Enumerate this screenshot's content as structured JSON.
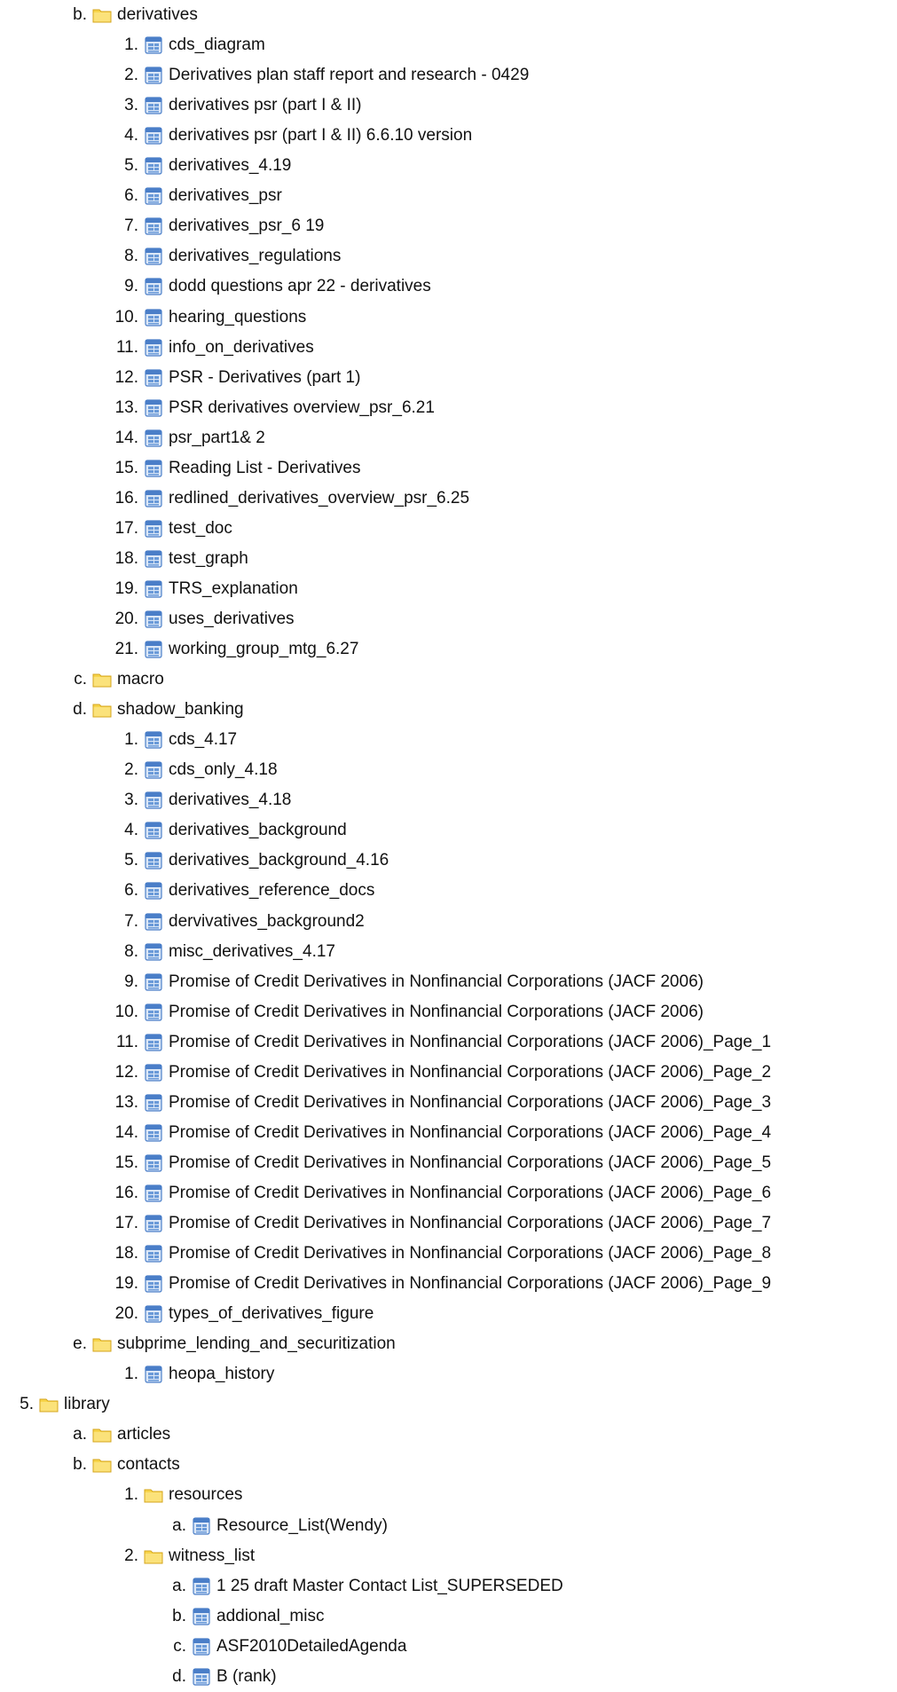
{
  "items": [
    {
      "marker": "b.",
      "type": "folder",
      "label": "derivatives"
    },
    {
      "marker": "1.",
      "type": "doc",
      "label": "cds_diagram"
    },
    {
      "marker": "2.",
      "type": "doc",
      "label": "Derivatives plan staff report and research - 0429"
    },
    {
      "marker": "3.",
      "type": "doc",
      "label": "derivatives psr (part I & II)"
    },
    {
      "marker": "4.",
      "type": "doc",
      "label": "derivatives psr (part I & II) 6.6.10 version"
    },
    {
      "marker": "5.",
      "type": "doc",
      "label": "derivatives_4.19"
    },
    {
      "marker": "6.",
      "type": "doc",
      "label": "derivatives_psr"
    },
    {
      "marker": "7.",
      "type": "doc",
      "label": "derivatives_psr_6 19"
    },
    {
      "marker": "8.",
      "type": "doc",
      "label": "derivatives_regulations"
    },
    {
      "marker": "9.",
      "type": "doc",
      "label": "dodd questions apr 22 - derivatives"
    },
    {
      "marker": "10.",
      "type": "doc",
      "label": "hearing_questions"
    },
    {
      "marker": "11.",
      "type": "doc",
      "label": "info_on_derivatives"
    },
    {
      "marker": "12.",
      "type": "doc",
      "label": "PSR - Derivatives (part 1)"
    },
    {
      "marker": "13.",
      "type": "doc",
      "label": "PSR derivatives overview_psr_6.21"
    },
    {
      "marker": "14.",
      "type": "doc",
      "label": "psr_part1& 2"
    },
    {
      "marker": "15.",
      "type": "doc",
      "label": "Reading List - Derivatives"
    },
    {
      "marker": "16.",
      "type": "doc",
      "label": "redlined_derivatives_overview_psr_6.25"
    },
    {
      "marker": "17.",
      "type": "doc",
      "label": "test_doc"
    },
    {
      "marker": "18.",
      "type": "doc",
      "label": "test_graph"
    },
    {
      "marker": "19.",
      "type": "doc",
      "label": "TRS_explanation"
    },
    {
      "marker": "20.",
      "type": "doc",
      "label": "uses_derivatives"
    },
    {
      "marker": "21.",
      "type": "doc",
      "label": "working_group_mtg_6.27"
    },
    {
      "marker": "c.",
      "type": "folder",
      "label": "macro"
    },
    {
      "marker": "d.",
      "type": "folder",
      "label": "shadow_banking"
    },
    {
      "marker": "1.",
      "type": "doc",
      "label": "cds_4.17"
    },
    {
      "marker": "2.",
      "type": "doc",
      "label": "cds_only_4.18"
    },
    {
      "marker": "3.",
      "type": "doc",
      "label": "derivatives_4.18"
    },
    {
      "marker": "4.",
      "type": "doc",
      "label": "derivatives_background"
    },
    {
      "marker": "5.",
      "type": "doc",
      "label": "derivatives_background_4.16"
    },
    {
      "marker": "6.",
      "type": "doc",
      "label": "derivatives_reference_docs"
    },
    {
      "marker": "7.",
      "type": "doc",
      "label": "dervivatives_background2"
    },
    {
      "marker": "8.",
      "type": "doc",
      "label": "misc_derivatives_4.17"
    },
    {
      "marker": "9.",
      "type": "doc",
      "label": "Promise of Credit Derivatives in Nonfinancial Corporations (JACF 2006)"
    },
    {
      "marker": "10.",
      "type": "doc",
      "label": "Promise of Credit Derivatives in Nonfinancial Corporations (JACF 2006)"
    },
    {
      "marker": "11.",
      "type": "doc",
      "label": "Promise of Credit Derivatives in Nonfinancial Corporations (JACF 2006)_Page_1"
    },
    {
      "marker": "12.",
      "type": "doc",
      "label": "Promise of Credit Derivatives in Nonfinancial Corporations (JACF 2006)_Page_2"
    },
    {
      "marker": "13.",
      "type": "doc",
      "label": "Promise of Credit Derivatives in Nonfinancial Corporations (JACF 2006)_Page_3"
    },
    {
      "marker": "14.",
      "type": "doc",
      "label": "Promise of Credit Derivatives in Nonfinancial Corporations (JACF 2006)_Page_4"
    },
    {
      "marker": "15.",
      "type": "doc",
      "label": "Promise of Credit Derivatives in Nonfinancial Corporations (JACF 2006)_Page_5"
    },
    {
      "marker": "16.",
      "type": "doc",
      "label": "Promise of Credit Derivatives in Nonfinancial Corporations (JACF 2006)_Page_6"
    },
    {
      "marker": "17.",
      "type": "doc",
      "label": "Promise of Credit Derivatives in Nonfinancial Corporations (JACF 2006)_Page_7"
    },
    {
      "marker": "18.",
      "type": "doc",
      "label": "Promise of Credit Derivatives in Nonfinancial Corporations (JACF 2006)_Page_8"
    },
    {
      "marker": "19.",
      "type": "doc",
      "label": "Promise of Credit Derivatives in Nonfinancial Corporations (JACF 2006)_Page_9"
    },
    {
      "marker": "20.",
      "type": "doc",
      "label": "types_of_derivatives_figure"
    },
    {
      "marker": "e.",
      "type": "folder",
      "label": "subprime_lending_and_securitization"
    },
    {
      "marker": "1.",
      "type": "doc",
      "label": "heopa_history"
    },
    {
      "marker": "5.",
      "type": "folder",
      "label": "library"
    },
    {
      "marker": "a.",
      "type": "folder",
      "label": "articles"
    },
    {
      "marker": "b.",
      "type": "folder",
      "label": "contacts"
    },
    {
      "marker": "1.",
      "type": "folder",
      "label": "resources"
    },
    {
      "marker": "a.",
      "type": "doc",
      "label": "Resource_List(Wendy)"
    },
    {
      "marker": "2.",
      "type": "folder",
      "label": "witness_list"
    },
    {
      "marker": "a.",
      "type": "doc",
      "label": "1 25 draft Master Contact List_SUPERSEDED"
    },
    {
      "marker": "b.",
      "type": "doc",
      "label": "addional_misc"
    },
    {
      "marker": "c.",
      "type": "doc",
      "label": "ASF2010DetailedAgenda"
    },
    {
      "marker": "d.",
      "type": "doc",
      "label": "B (rank)"
    }
  ]
}
